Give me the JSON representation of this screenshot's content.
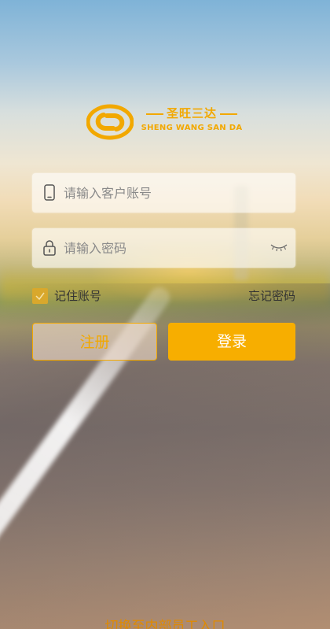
{
  "brand": {
    "name_cn": "圣旺三达",
    "name_en": "SHENG WANG SAN DA",
    "color": "#f2a800"
  },
  "form": {
    "account": {
      "placeholder": "请输入客户账号",
      "icon": "phone-icon"
    },
    "password": {
      "placeholder": "请输入密码",
      "icon": "lock-icon",
      "toggle_icon": "eye-closed-icon"
    },
    "remember_label": "记住账号",
    "remember_checked": true,
    "forgot_label": "忘记密码"
  },
  "buttons": {
    "register": "注册",
    "login": "登录"
  },
  "footer": {
    "switch_link": "切换至内部员工入口"
  }
}
